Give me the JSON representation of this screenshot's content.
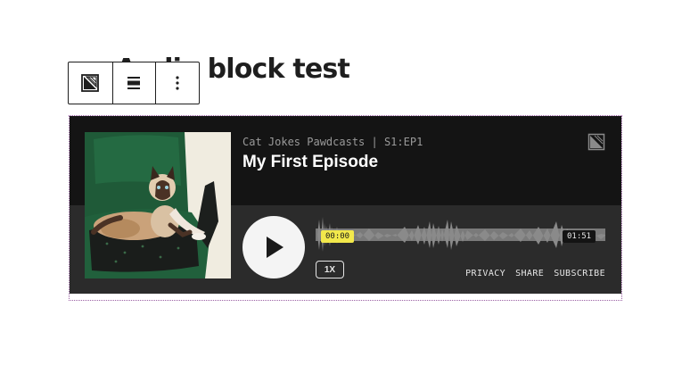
{
  "editor": {
    "page_title": "Audio block test"
  },
  "toolbar": {
    "items": [
      {
        "icon": "podcast-block-icon"
      },
      {
        "icon": "align-icon"
      },
      {
        "icon": "more-options-icon"
      }
    ]
  },
  "player": {
    "show_meta": "Cat Jokes Pawdcasts | S1:EP1",
    "episode_title": "My First Episode",
    "time_current": "00:00",
    "time_total": "01:51",
    "speed": "1X",
    "links": [
      "PRIVACY",
      "SHARE",
      "SUBSCRIBE"
    ],
    "colors": {
      "background": "#141414",
      "control_bar": "#2b2b2b",
      "waveform": "#8a8a8a",
      "time_highlight": "#f2e84b"
    },
    "cover_icon": "cat-on-green-chair-photo"
  }
}
